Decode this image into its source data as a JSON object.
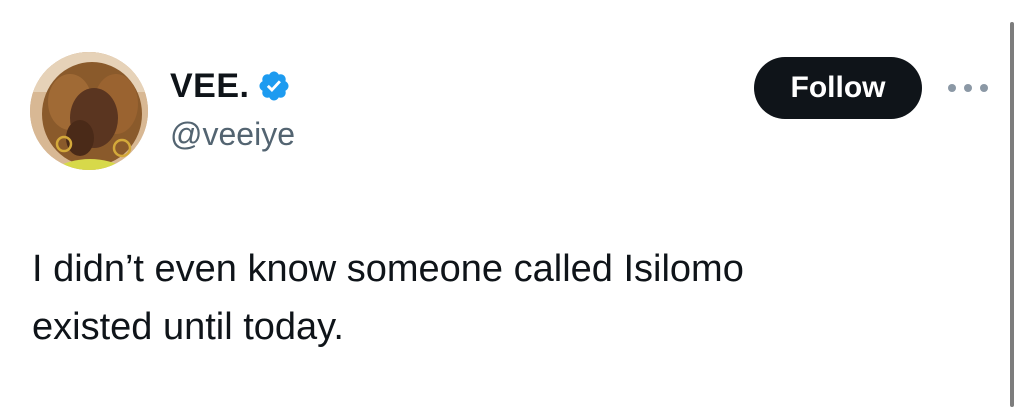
{
  "tweet": {
    "author": {
      "display_name": "VEE.",
      "handle": "@veeiye",
      "verified": true
    },
    "follow_label": "Follow",
    "text_line1": "I didn’t even know someone called Isilomo",
    "text_line2": "existed until today."
  },
  "icons": {
    "verified": "verified-badge-icon",
    "more": "more-options-icon"
  },
  "colors": {
    "verified_blue": "#1d9bf0",
    "follow_bg": "#0f1419",
    "handle_gray": "#536471"
  }
}
